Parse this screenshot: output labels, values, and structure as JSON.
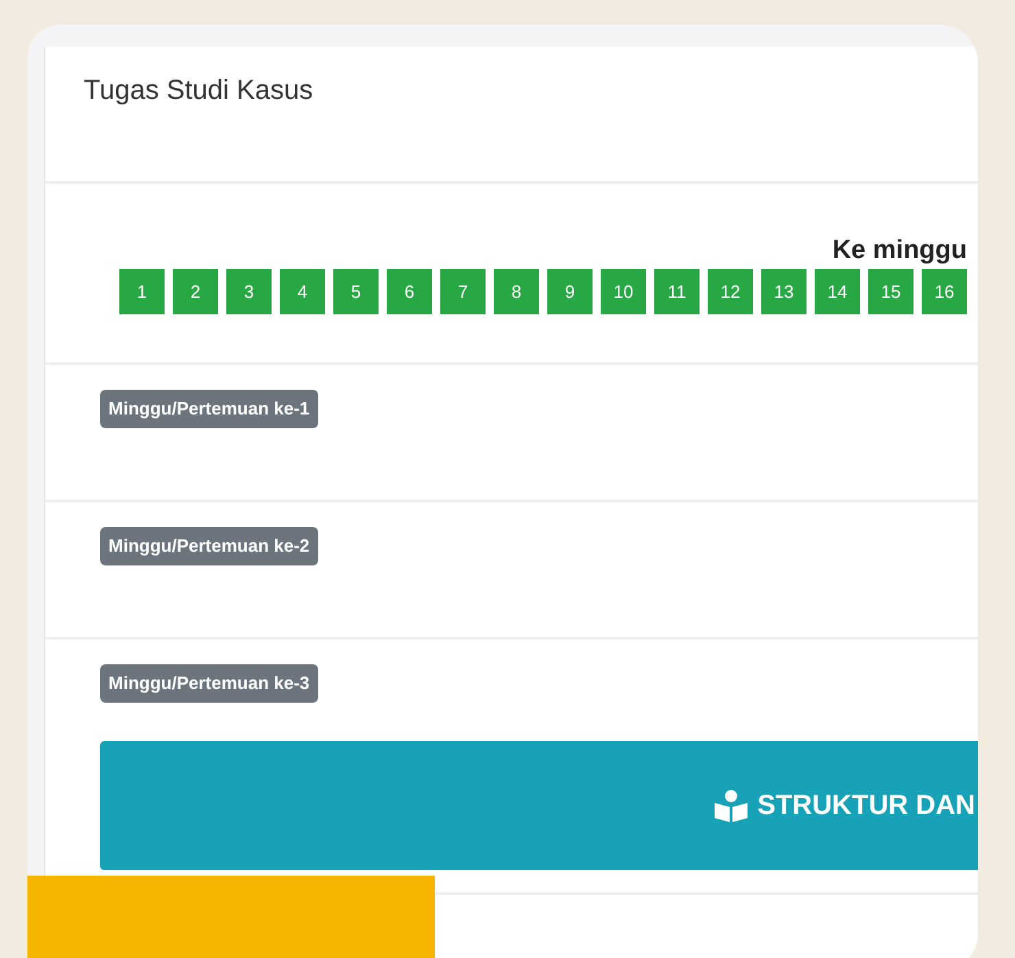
{
  "card": {
    "title": "Tugas Studi Kasus"
  },
  "week_nav": {
    "label": "Ke minggu",
    "weeks": [
      "1",
      "2",
      "3",
      "4",
      "5",
      "6",
      "7",
      "8",
      "9",
      "10",
      "11",
      "12",
      "13",
      "14",
      "15",
      "16"
    ]
  },
  "sections": [
    {
      "badge": "Minggu/Pertemuan ke-1"
    },
    {
      "badge": "Minggu/Pertemuan ke-2"
    },
    {
      "badge": "Minggu/Pertemuan ke-3",
      "button": "STRUKTUR DAN"
    }
  ]
}
